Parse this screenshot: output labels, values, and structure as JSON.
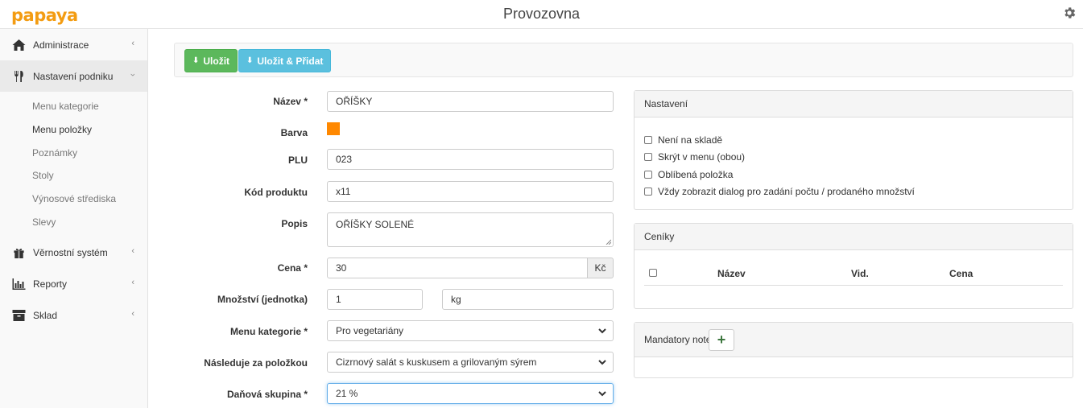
{
  "app": {
    "logo": "papaya",
    "title": "Provozovna"
  },
  "sidebar": {
    "items": [
      {
        "label": "Administrace",
        "icon": "home-icon"
      },
      {
        "label": "Nastavení podniku",
        "icon": "cutlery-icon"
      },
      {
        "label": "Věrnostní systém",
        "icon": "gift-icon"
      },
      {
        "label": "Reporty",
        "icon": "bar-chart-icon"
      },
      {
        "label": "Sklad",
        "icon": "archive-icon"
      }
    ],
    "sub_items": [
      "Menu kategorie",
      "Menu položky",
      "Poznámky",
      "Stoly",
      "Výnosové střediska",
      "Slevy"
    ]
  },
  "toolbar": {
    "save_label": "Uložit",
    "save_add_label": "Uložit & Přidat"
  },
  "form": {
    "name_label": "Název *",
    "name_value": "OŘÍŠKY",
    "color_label": "Barva",
    "color_value": "#ff8800",
    "plu_label": "PLU",
    "plu_value": "023",
    "code_label": "Kód produktu",
    "code_value": "x11",
    "desc_label": "Popis",
    "desc_value": "OŘÍŠKY SOLENÉ",
    "price_label": "Cena *",
    "price_value": "30",
    "currency": "Kč",
    "qty_label": "Množství (jednotka)",
    "qty_value": "1",
    "unit_value": "kg",
    "category_label": "Menu kategorie *",
    "category_value": "Pro vegetariány",
    "follows_label": "Následuje za položkou",
    "follows_value": "Cizrnový salát s kuskusem a grilovaným sýrem",
    "tax_label": "Daňová skupina *",
    "tax_value": "21 %"
  },
  "settings": {
    "title": "Nastavení",
    "options": [
      "Není na skladě",
      "Skrýt v menu (obou)",
      "Oblíbená položka",
      "Vždy zobrazit dialog pro zadání počtu / prodaného množství"
    ]
  },
  "pricelists": {
    "title": "Ceníky",
    "columns": [
      "Název",
      "Vid.",
      "Cena"
    ]
  },
  "mandatory": {
    "title": "Mandatory note",
    "add_label": "+"
  }
}
